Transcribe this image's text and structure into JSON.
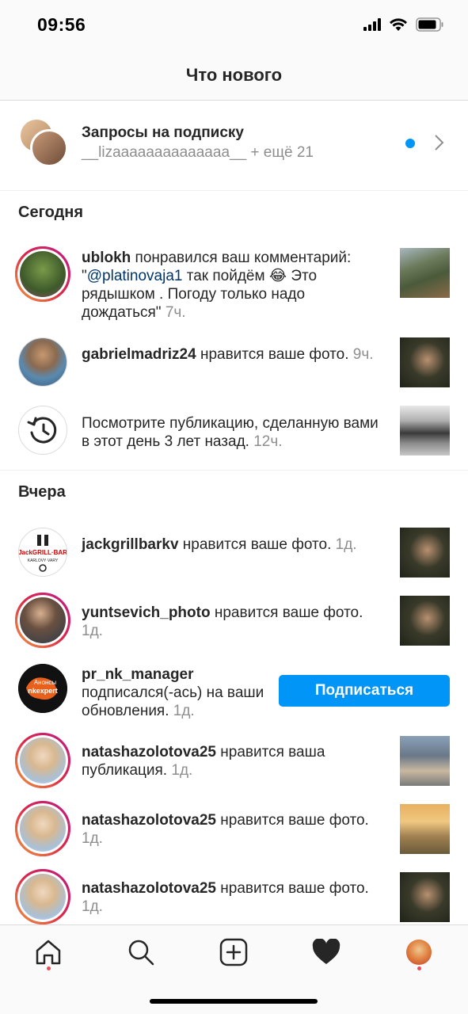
{
  "status": {
    "time": "09:56"
  },
  "header": {
    "title": "Что нового"
  },
  "follow_requests": {
    "title": "Запросы на подписку",
    "subtitle": "__lizaaaaaaaaaaaaaa__ + ещё 21"
  },
  "sections": {
    "today": "Сегодня",
    "yesterday": "Вчера"
  },
  "notifications": [
    {
      "user": "ublokh",
      "action": " понравился ваш комментарий: \"",
      "mention": "@platinovaja1",
      "rest": " так пойдём 😂 Это рядышком . Погоду только надо дождаться\" ",
      "time": "7ч."
    },
    {
      "user": "gabrielmadriz24",
      "action": " нравится ваше фото. ",
      "time": "9ч."
    },
    {
      "text": "Посмотрите публикацию, сделанную вами в этот день 3 лет назад. ",
      "time": "12ч."
    },
    {
      "user": "jackgrillbarkv",
      "action": " нравится ваше фото. ",
      "time": "1д."
    },
    {
      "user": "yuntsevich_photo",
      "action": " нравится ваше фото. ",
      "time": "1д."
    },
    {
      "user": "pr_nk_manager",
      "action": "подписался(-ась) на ваши обновления. ",
      "time": "1д.",
      "button": "Подписаться"
    },
    {
      "user": "natashazolotova25",
      "action": " нравится ваша публикация. ",
      "time": "1д."
    },
    {
      "user": "natashazolotova25",
      "action": " нравится ваше фото. ",
      "time": "1д."
    },
    {
      "user": "natashazolotova25",
      "action": " нравится ваше фото. ",
      "time": "1д."
    }
  ],
  "logos": {
    "jack_top": "JackGRILL·BAR",
    "jack_bottom": "KARLOVY·VARY",
    "pr_top": "Анонсы",
    "pr_bottom": "nkexpert"
  },
  "colors": {
    "accent": "#0095f6",
    "notify": "#ed4956",
    "muted": "#8e8e8e"
  },
  "tabs": [
    "home-icon",
    "search-icon",
    "add-post-icon",
    "heart-icon",
    "profile-avatar"
  ]
}
